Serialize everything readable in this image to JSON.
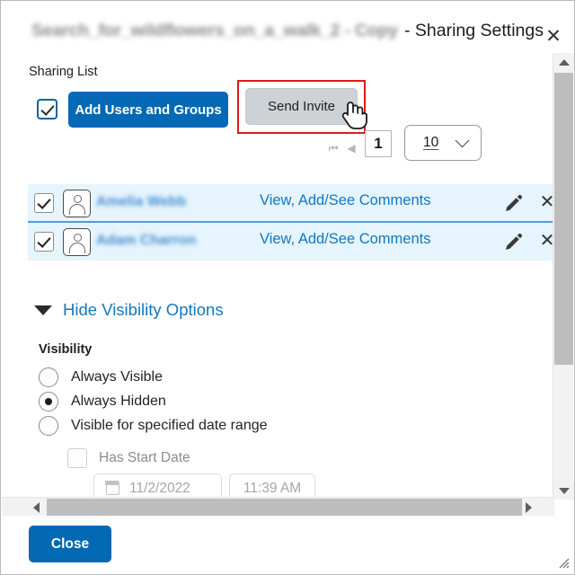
{
  "dialog": {
    "title_redacted": "Search_for_wildflowers_on_a_walk_2 - Copy",
    "title_suffix": "- Sharing Settings",
    "close_icon": "close-icon",
    "close_glyph": "✕"
  },
  "sharing": {
    "list_label": "Sharing List",
    "select_all_checked": true,
    "add_users_label": "Add Users and Groups",
    "send_invite_label": "Send Invite",
    "highlight_color": "#e01b1b",
    "primary_color": "#0469b5",
    "link_color": "#1178c1",
    "row_background": "#e5f4fd"
  },
  "pagination": {
    "first_glyph": "⏮",
    "prev_glyph": "◀",
    "next_glyph": "▶",
    "last_glyph": "⏭",
    "current_page": "1",
    "page_size": "10"
  },
  "users": [
    {
      "checked": true,
      "name": "Amelia Webb",
      "permission": "View, Add/See Comments",
      "edit_icon": "pencil-icon",
      "remove_icon": "close-icon",
      "remove_glyph": "✕"
    },
    {
      "checked": true,
      "name": "Adam Charron",
      "permission": "View, Add/See Comments",
      "edit_icon": "pencil-icon",
      "remove_icon": "close-icon",
      "remove_glyph": "✕"
    }
  ],
  "visibility": {
    "toggle_label": "Hide Visibility Options",
    "toggle_icon": "caret-down-icon",
    "heading": "Visibility",
    "options": [
      {
        "label": "Always Visible",
        "selected": false
      },
      {
        "label": "Always Hidden",
        "selected": true
      },
      {
        "label": "Visible for specified date range",
        "selected": false
      }
    ],
    "start_date": {
      "checkbox_label": "Has Start Date",
      "checked": false,
      "enabled": false,
      "calendar_icon": "calendar-icon",
      "date_value": "11/2/2022",
      "time_value": "11:39 AM"
    }
  },
  "scrollbars": {
    "vertical_up_icon": "triangle-up-icon",
    "vertical_down_icon": "triangle-down-icon",
    "horizontal_left_icon": "triangle-left-icon",
    "horizontal_right_icon": "triangle-right-icon"
  },
  "footer": {
    "close_label": "Close",
    "resize_grip_icon": "resize-grip-icon"
  }
}
